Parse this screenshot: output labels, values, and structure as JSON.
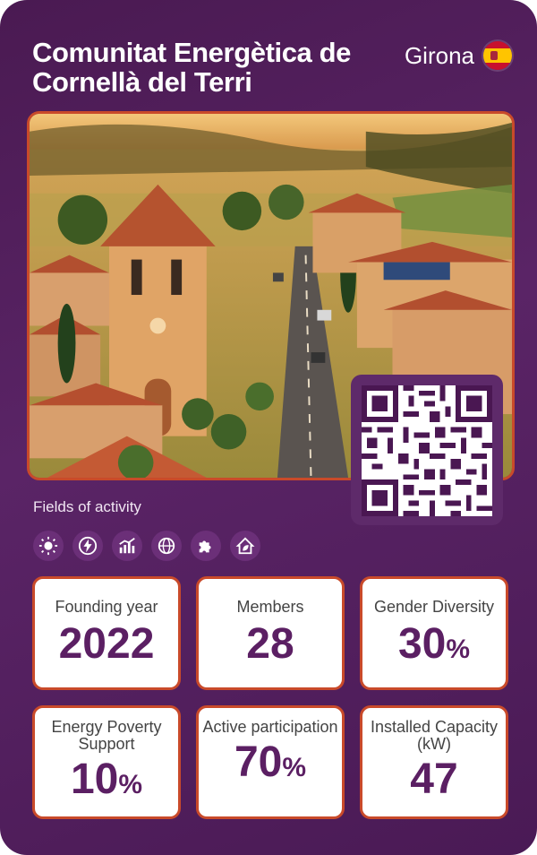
{
  "header": {
    "title": "Comunitat Energètica de Cornellà del Terri",
    "region": "Girona",
    "flag_icon": "spain-flag-icon"
  },
  "fields": {
    "label": "Fields of activity",
    "icons": [
      "sun-icon",
      "lightning-bolt-icon",
      "efficiency-chart-icon",
      "globe-icon",
      "puzzle-piece-icon",
      "house-leaf-icon"
    ]
  },
  "stats": [
    {
      "label": "Founding year",
      "value": "2022",
      "unit": ""
    },
    {
      "label": "Members",
      "value": "28",
      "unit": ""
    },
    {
      "label": "Gender Diversity",
      "value": "30",
      "unit": "%"
    },
    {
      "label": "Energy Poverty Support",
      "value": "10",
      "unit": "%"
    },
    {
      "label": "Active participation",
      "value": "70",
      "unit": "%"
    },
    {
      "label": "Installed Capacity (kW)",
      "value": "47",
      "unit": ""
    }
  ],
  "colors": {
    "background": "#4f1c59",
    "accent_border": "#c94a2a",
    "value_text": "#5b1f63"
  }
}
